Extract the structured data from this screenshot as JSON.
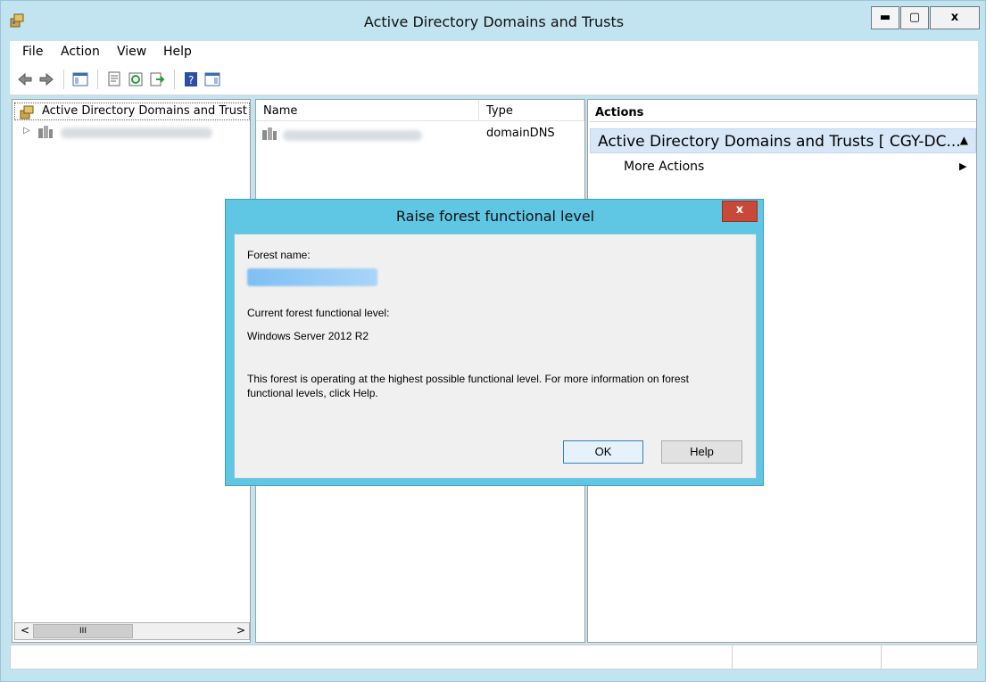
{
  "window": {
    "title": "Active Directory Domains and Trusts",
    "controls": {
      "minimize": "▬",
      "maximize": "▢",
      "close": "x"
    }
  },
  "menu": [
    "File",
    "Action",
    "View",
    "Help"
  ],
  "toolbar_icons": [
    "back-icon",
    "forward-icon",
    "show-hide-console-tree-icon",
    "properties-icon",
    "refresh-icon",
    "export-list-icon",
    "help-icon",
    "show-hide-action-pane-icon"
  ],
  "tree": {
    "root_label": "Active Directory Domains and Trust",
    "expand_glyph": "▷"
  },
  "list": {
    "columns": [
      "Name",
      "Type"
    ],
    "rows": [
      {
        "type": "domainDNS"
      }
    ]
  },
  "scrollbar": {
    "left": "<",
    "grip": "III",
    "right": ">"
  },
  "actions": {
    "header": "Actions",
    "group": "Active Directory Domains and Trusts [ CGY-DC...",
    "group_glyph": "▲",
    "items": [
      {
        "label": "More Actions",
        "glyph": "▶"
      }
    ]
  },
  "dialog": {
    "title": "Raise forest functional level",
    "close": "x",
    "forest_name_label": "Forest name:",
    "current_level_label": "Current forest functional level:",
    "current_level_value": "Windows Server 2012 R2",
    "message_line1": "This forest is operating at the highest possible functional level. For more information on forest",
    "message_line2": "functional levels, click Help.",
    "ok": "OK",
    "help": "Help"
  }
}
